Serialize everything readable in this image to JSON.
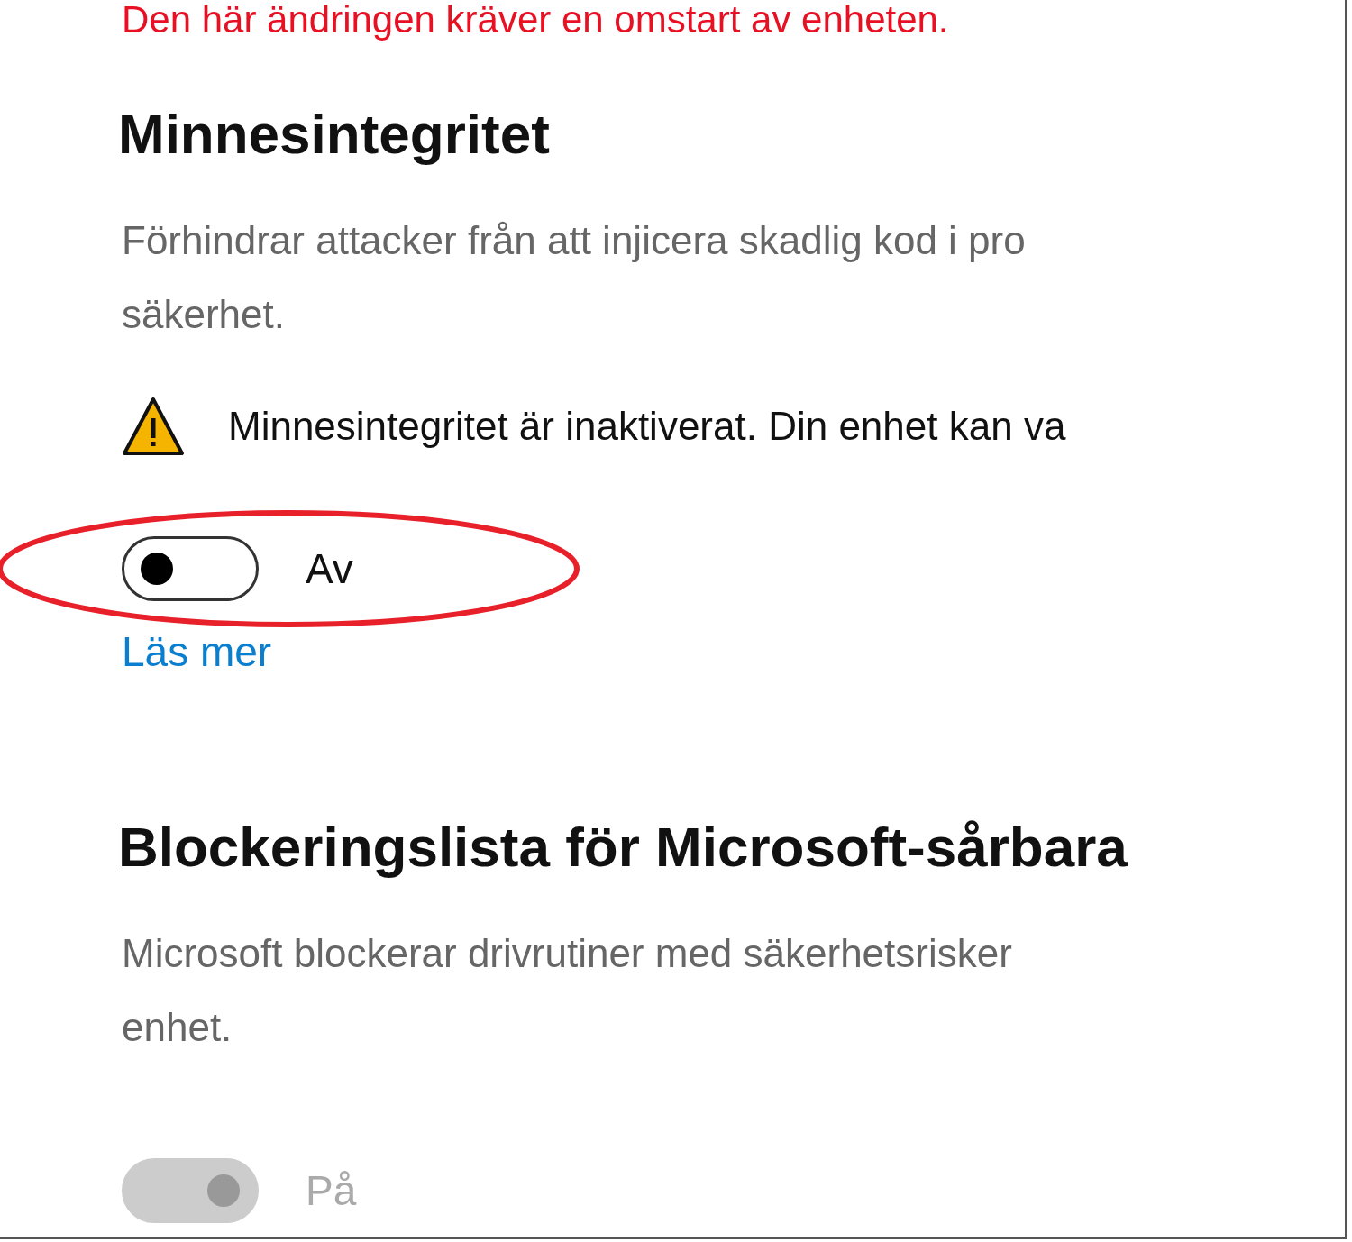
{
  "notice": {
    "text": "Den här ändringen kräver en omstart av enheten."
  },
  "sections": [
    {
      "title": "Minnesintegritet",
      "description": "Förhindrar attacker från att injicera skadlig kod i pro\nsäkerhet.",
      "warning": "Minnesintegritet är inaktiverat. Din enhet kan va",
      "toggle": {
        "on": false,
        "disabled": false,
        "label": "Av"
      },
      "highlighted": true,
      "link": "Läs mer"
    },
    {
      "title": "Blockeringslista för Microsoft-sårbara",
      "description": "Microsoft blockerar drivrutiner med säkerhetsrisker\nenhet.",
      "toggle": {
        "on": true,
        "disabled": true,
        "label": "På"
      },
      "highlighted": false
    }
  ]
}
